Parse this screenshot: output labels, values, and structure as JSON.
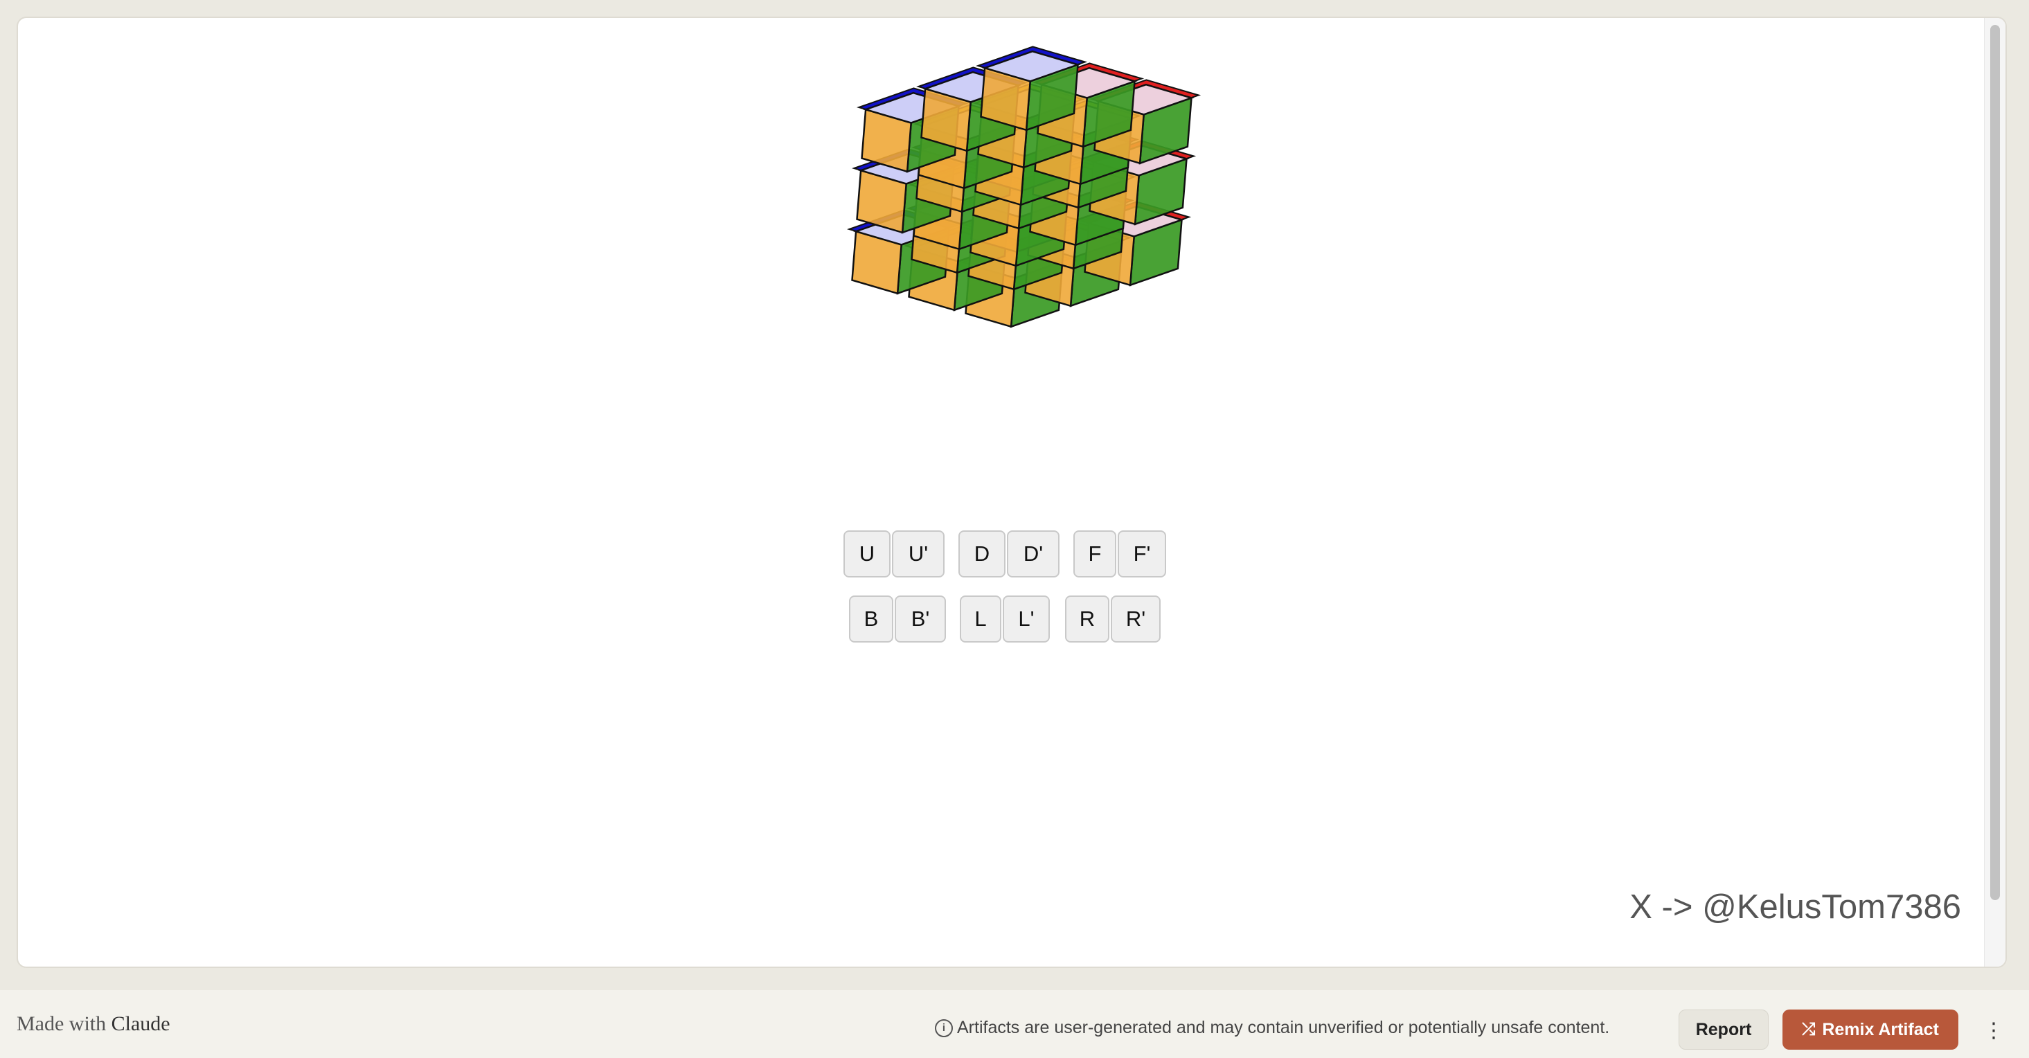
{
  "controls": {
    "row1": [
      {
        "label": "U"
      },
      {
        "label": "U'"
      },
      {
        "label": "D"
      },
      {
        "label": "D'"
      },
      {
        "label": "F"
      },
      {
        "label": "F'"
      }
    ],
    "row2": [
      {
        "label": "B"
      },
      {
        "label": "B'"
      },
      {
        "label": "L"
      },
      {
        "label": "L'"
      },
      {
        "label": "R"
      },
      {
        "label": "R'"
      }
    ]
  },
  "credit": "X -> @KelusTom7386",
  "footer": {
    "made_with": "Made with",
    "brand": "Claude",
    "notice": "Artifacts are user-generated and may contain unverified or potentially unsafe content.",
    "report_label": "Report",
    "remix_label": "Remix Artifact",
    "more_label": "⋮"
  },
  "cube": {
    "colors": {
      "top": "#eef0ff",
      "left": "#f0a838",
      "right": "#3a9a24",
      "edge_blue": "#1212c8",
      "edge_red": "#e02020",
      "edge_yellow": "#f2e21a",
      "outline": "#111111"
    }
  },
  "colors": {
    "accent": "#b8583a",
    "frame_bg": "#ffffff",
    "page_bg": "#ebe9e1"
  },
  "icons": {
    "info": "info-icon",
    "remix": "shuffle-icon",
    "more": "more-vertical-icon"
  }
}
